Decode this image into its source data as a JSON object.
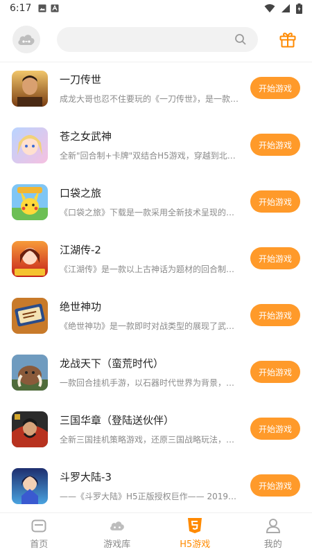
{
  "status_bar": {
    "time": "6:17"
  },
  "header": {
    "search_placeholder": "",
    "icons": {
      "left": "cloud-game-icon",
      "search": "search-icon",
      "right": "gift-icon"
    }
  },
  "games": [
    {
      "title": "一刀传世",
      "desc": "成龙大哥也忍不住要玩的《一刀传世》，是一款集…",
      "button": "开始游戏"
    },
    {
      "title": "苍之女武神",
      "desc": "全新\"回合制+卡牌\"双结合H5游戏，穿越到北欧希…",
      "button": "开始游戏"
    },
    {
      "title": "口袋之旅",
      "desc": "《口袋之旅》下载是一款采用全新技术呈现的角色…",
      "button": "开始游戏"
    },
    {
      "title": "江湖传-2",
      "desc": "《江湖传》是一款以上古神话为题材的回合制游戏…",
      "button": "开始游戏"
    },
    {
      "title": "绝世神功",
      "desc": "《绝世神功》是一款即时对战类型的展现了武侠江…",
      "button": "开始游戏"
    },
    {
      "title": "龙战天下（蛮荒时代）",
      "desc": "一款回合挂机手游，以石器时代世界为背景，你将…",
      "button": "开始游戏"
    },
    {
      "title": "三国华章（登陆送伙伴）",
      "desc": "全新三国挂机策略游戏，还原三国战略玩法，在汉…",
      "button": "开始游戏"
    },
    {
      "title": "斗罗大陆-3",
      "desc": "——《斗罗大陆》H5正版授权巨作—— 2019年度沉…",
      "button": "开始游戏"
    }
  ],
  "nav": [
    {
      "label": "首页",
      "icon": "home-icon"
    },
    {
      "label": "游戏库",
      "icon": "gamepad-cloud-icon"
    },
    {
      "label": "H5游戏",
      "icon": "html5-icon",
      "active": true
    },
    {
      "label": "我的",
      "icon": "user-icon"
    }
  ],
  "colors": {
    "accent": "#ff9a2a",
    "active_nav": "#ff8a00"
  }
}
